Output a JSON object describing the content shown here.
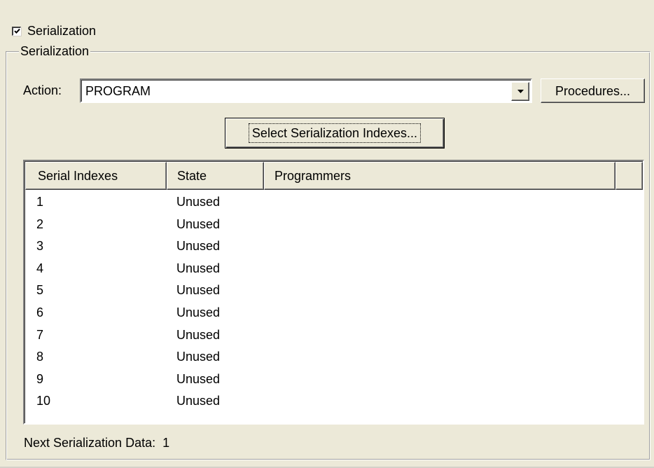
{
  "enable": {
    "label": "Serialization",
    "checked": true
  },
  "group": {
    "title": "Serialization"
  },
  "action": {
    "label": "Action:",
    "value": "PROGRAM",
    "dropdown_icon": "chevron-down-icon"
  },
  "buttons": {
    "procedures": "Procedures...",
    "select_indexes": "Select Serialization Indexes..."
  },
  "table": {
    "columns": [
      "Serial Indexes",
      "State",
      "Programmers"
    ],
    "rows": [
      {
        "index": "1",
        "state": "Unused",
        "programmers": ""
      },
      {
        "index": "2",
        "state": "Unused",
        "programmers": ""
      },
      {
        "index": "3",
        "state": "Unused",
        "programmers": ""
      },
      {
        "index": "4",
        "state": "Unused",
        "programmers": ""
      },
      {
        "index": "5",
        "state": "Unused",
        "programmers": ""
      },
      {
        "index": "6",
        "state": "Unused",
        "programmers": ""
      },
      {
        "index": "7",
        "state": "Unused",
        "programmers": ""
      },
      {
        "index": "8",
        "state": "Unused",
        "programmers": ""
      },
      {
        "index": "9",
        "state": "Unused",
        "programmers": ""
      },
      {
        "index": "10",
        "state": "Unused",
        "programmers": ""
      }
    ]
  },
  "footer": {
    "next_label": "Next Serialization Data:",
    "next_value": "1"
  }
}
